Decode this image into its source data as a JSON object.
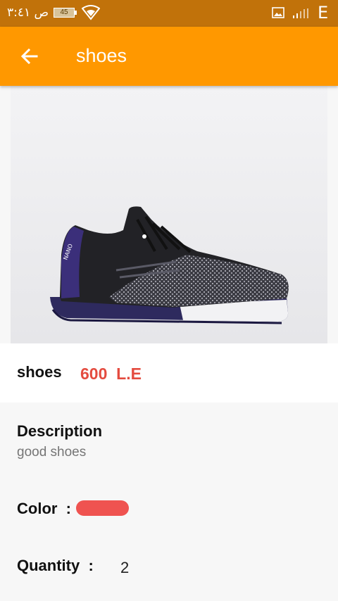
{
  "status_bar": {
    "time": "ص ٣:٤١",
    "battery": "45",
    "network": "E"
  },
  "app_bar": {
    "title": "shoes",
    "back_icon": "arrow-back-icon"
  },
  "product": {
    "image_icon": "sneaker-image",
    "name": "shoes",
    "price": "600  L.E",
    "description_label": "Description",
    "description": "good shoes",
    "color_label": "Color  :",
    "color_hex": "#ef5350",
    "quantity_label": "Quantity  :",
    "quantity": "2"
  },
  "colors": {
    "status_bar": "#c1720a",
    "app_bar": "#ff9800",
    "price": "#e44b3f"
  }
}
